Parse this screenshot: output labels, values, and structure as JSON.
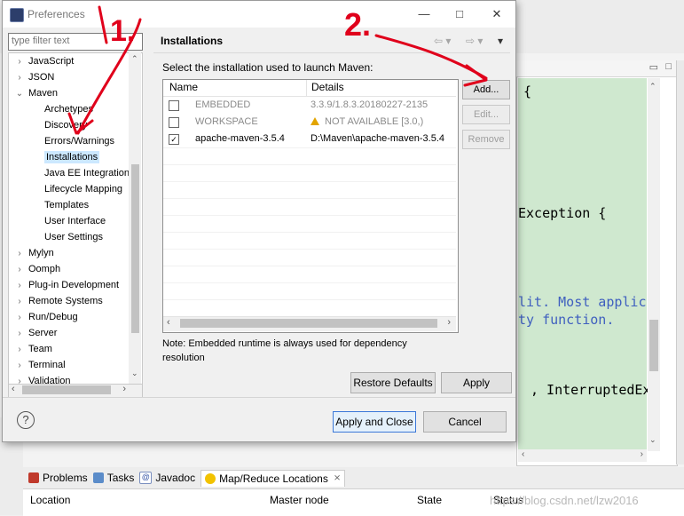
{
  "dialog": {
    "title": "Preferences",
    "filter_placeholder": "type filter text",
    "tree": [
      {
        "label": "JavaScript",
        "arrow": ">"
      },
      {
        "label": "JSON",
        "arrow": ">"
      },
      {
        "label": "Maven",
        "arrow": "v"
      },
      {
        "label": "Archetypes",
        "arrow": ""
      },
      {
        "label": "Discovery",
        "arrow": ""
      },
      {
        "label": "Errors/Warnings",
        "arrow": ""
      },
      {
        "label": "Installations",
        "arrow": ""
      },
      {
        "label": "Java EE Integration",
        "arrow": ""
      },
      {
        "label": "Lifecycle Mapping",
        "arrow": ""
      },
      {
        "label": "Templates",
        "arrow": ""
      },
      {
        "label": "User Interface",
        "arrow": ""
      },
      {
        "label": "User Settings",
        "arrow": ""
      },
      {
        "label": "Mylyn",
        "arrow": ">"
      },
      {
        "label": "Oomph",
        "arrow": ">"
      },
      {
        "label": "Plug-in Development",
        "arrow": ">"
      },
      {
        "label": "Remote Systems",
        "arrow": ">"
      },
      {
        "label": "Run/Debug",
        "arrow": ">"
      },
      {
        "label": "Server",
        "arrow": ">"
      },
      {
        "label": "Team",
        "arrow": ">"
      },
      {
        "label": "Terminal",
        "arrow": ">"
      },
      {
        "label": "Validation",
        "arrow": ">"
      }
    ],
    "page_title": "Installations",
    "page_description": "Select the installation used to launch Maven:",
    "table_headers": {
      "name": "Name",
      "details": "Details"
    },
    "installations": [
      {
        "checked": false,
        "name": "EMBEDDED",
        "details": "3.3.9/1.8.3.20180227-2135",
        "dimmed": true,
        "warning": false
      },
      {
        "checked": false,
        "name": "WORKSPACE",
        "details": "NOT AVAILABLE [3.0,)",
        "dimmed": true,
        "warning": true
      },
      {
        "checked": true,
        "name": "apache-maven-3.5.4",
        "details": "D:\\Maven\\apache-maven-3.5.4",
        "dimmed": false,
        "warning": false
      }
    ],
    "side_buttons": {
      "add": "Add...",
      "edit": "Edit...",
      "remove": "Remove"
    },
    "note": "Note: Embedded runtime is always used for dependency resolution",
    "restore_defaults": "Restore Defaults",
    "apply": "Apply",
    "apply_and_close": "Apply and Close",
    "cancel": "Cancel",
    "help_glyph": "?"
  },
  "editor": {
    "lines": [
      {
        "text": "{",
        "comment": false
      },
      {
        "text": "Exception {",
        "comment": false
      },
      {
        "text": "lit. Most applic",
        "comment": true
      },
      {
        "text": "ty function.",
        "comment": true
      },
      {
        "text": ", InterruptedExc",
        "comment": false
      }
    ]
  },
  "bottom_panel": {
    "tabs": [
      "Problems",
      "Tasks",
      "Javadoc",
      "Map/Reduce Locations"
    ],
    "columns": [
      "Location",
      "Master node",
      "State",
      "Status"
    ]
  },
  "watermark": "https://blog.csdn.net/lzw2016",
  "annotations": [
    "1.",
    "2."
  ],
  "colors": {
    "selection": "#cce8ff",
    "editor_bg": "#cfe8cf",
    "annotation_red": "#e0001b"
  }
}
